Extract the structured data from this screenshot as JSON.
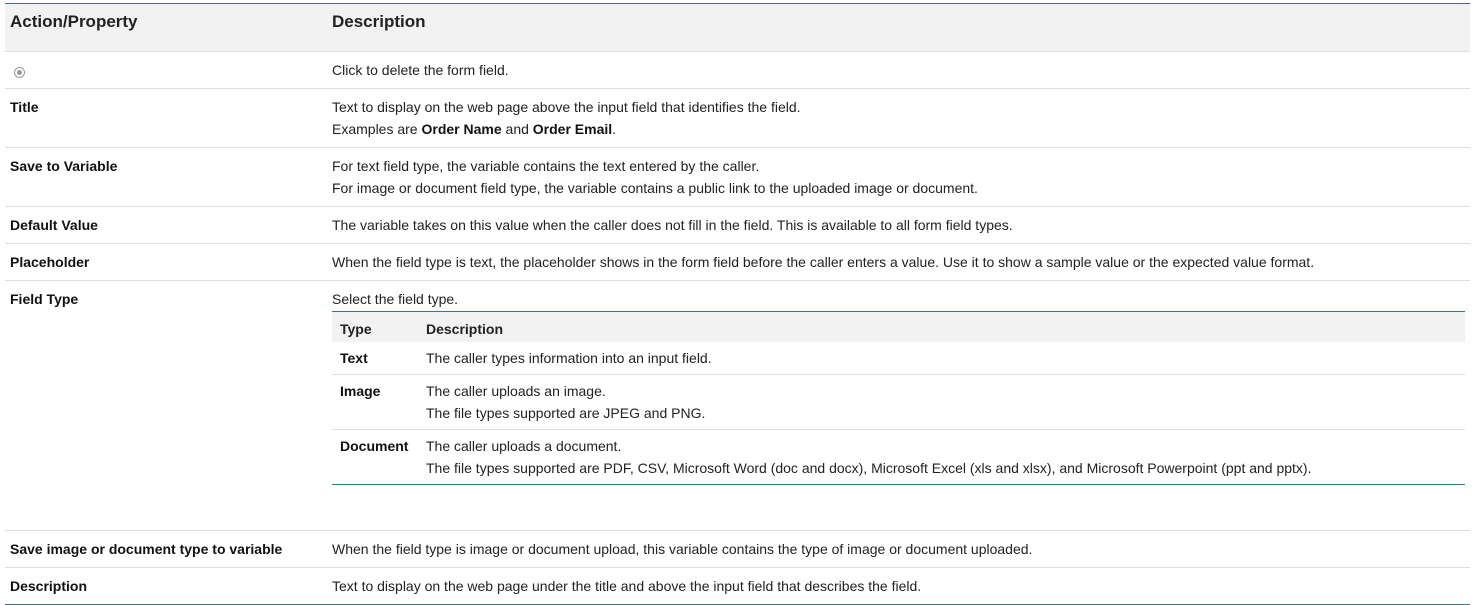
{
  "header": {
    "col1": "Action/Property",
    "col2": "Description"
  },
  "rows": {
    "delete": {
      "icon": "delete-circle-icon",
      "desc": "Click to delete the form field."
    },
    "title": {
      "label": "Title",
      "line1": "Text to display on the web page above the input field that identifies the field.",
      "line2_pre": "Examples are ",
      "ex1": "Order Name",
      "line2_mid": " and ",
      "ex2": "Order Email",
      "line2_post": "."
    },
    "save_to_variable": {
      "label": "Save to Variable",
      "line1": "For text field type, the variable contains the text entered by the caller.",
      "line2": "For image or document field type, the variable contains a public link to the uploaded image or document."
    },
    "default_value": {
      "label": "Default Value",
      "desc": "The variable takes on this value when the caller does not fill in the field. This is available to all form field types."
    },
    "placeholder": {
      "label": "Placeholder",
      "desc": "When the field type is text, the placeholder shows in the form field before the caller enters a value. Use it to show a sample value or the expected value format."
    },
    "field_type": {
      "label": "Field Type",
      "intro": "Select the field type.",
      "sub_header": {
        "col1": "Type",
        "col2": "Description"
      },
      "sub_rows": {
        "text": {
          "type": "Text",
          "line1": "The caller types information into an input field."
        },
        "image": {
          "type": "Image",
          "line1": "The caller uploads an image.",
          "line2": "The file types supported are JPEG and PNG."
        },
        "document": {
          "type": "Document",
          "line1": "The caller uploads a document.",
          "line2": "The file types supported are PDF, CSV, Microsoft Word (doc and docx), Microsoft Excel (xls and xlsx), and Microsoft Powerpoint (ppt and pptx)."
        }
      }
    },
    "save_type": {
      "label": "Save image or document type to variable",
      "desc": "When the field type is image or document upload, this variable contains the type of image or document uploaded."
    },
    "description": {
      "label": "Description",
      "desc": "Text to display on the web page under the title and above the input field that describes the field."
    }
  }
}
